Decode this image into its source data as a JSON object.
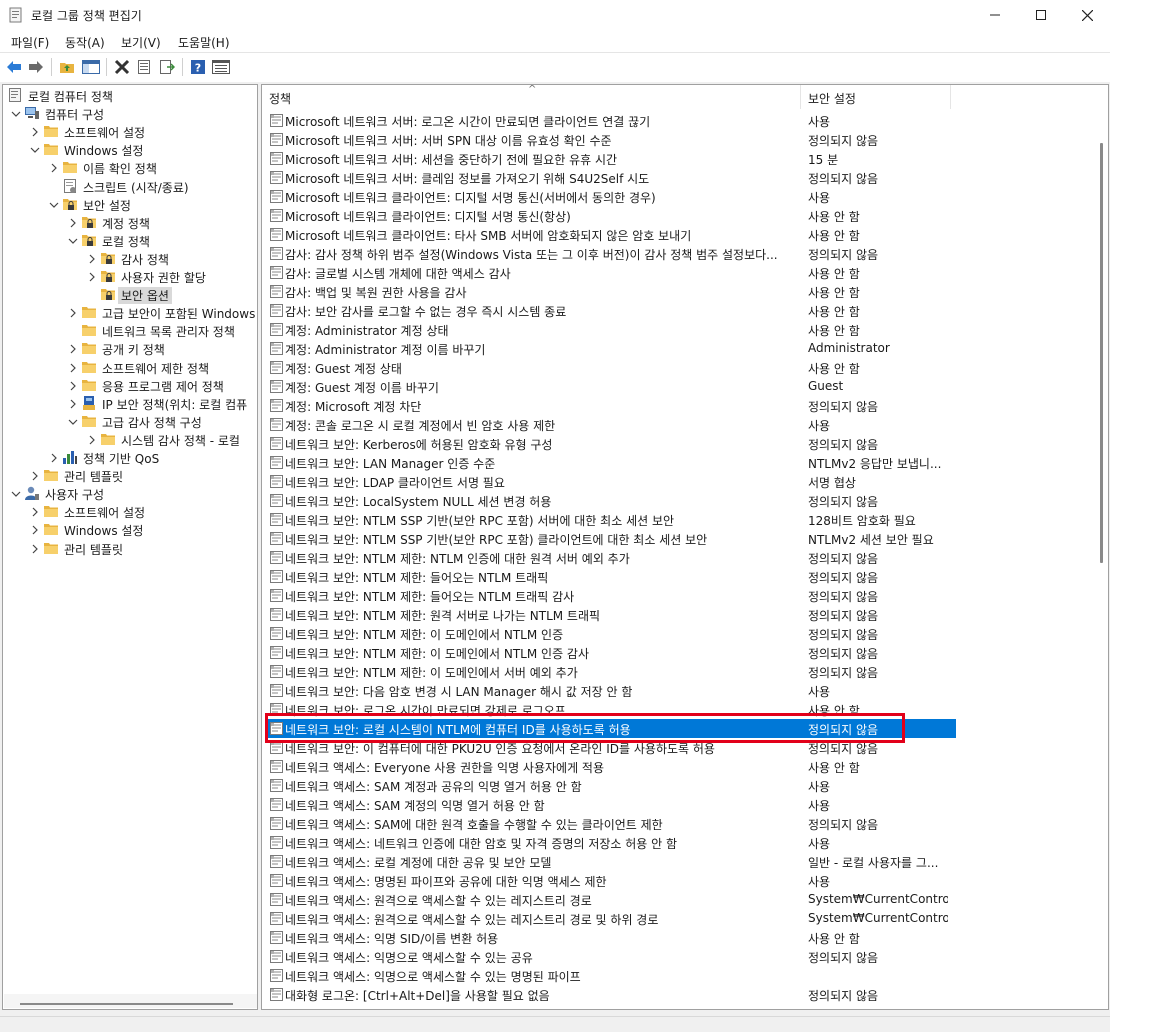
{
  "window": {
    "title": "로컬 그룹 정책 편집기"
  },
  "menu": [
    {
      "label": "파일(F)"
    },
    {
      "label": "동작(A)"
    },
    {
      "label": "보기(V)"
    },
    {
      "label": "도움말(H)"
    }
  ],
  "toolbar": {
    "icons": [
      "back-icon",
      "forward-icon",
      "up-folder-icon",
      "show-hide-tree-icon",
      "delete-icon",
      "properties-icon",
      "export-list-icon",
      "help-icon",
      "details-view-icon"
    ]
  },
  "tree": [
    {
      "label": "로컬 컴퓨터 정책",
      "level": 0,
      "chevron": "none",
      "icon": "policy"
    },
    {
      "label": "컴퓨터 구성",
      "level": 1,
      "chevron": "down",
      "icon": "computer"
    },
    {
      "label": "소프트웨어 설정",
      "level": 2,
      "chevron": "right",
      "icon": "folder"
    },
    {
      "label": "Windows 설정",
      "level": 2,
      "chevron": "down",
      "icon": "folder"
    },
    {
      "label": "이름 확인 정책",
      "level": 3,
      "chevron": "right",
      "icon": "folder"
    },
    {
      "label": "스크립트 (시작/종료)",
      "level": 3,
      "chevron": "none",
      "icon": "script"
    },
    {
      "label": "보안 설정",
      "level": 3,
      "chevron": "down",
      "icon": "secfolder"
    },
    {
      "label": "계정 정책",
      "level": 4,
      "chevron": "right",
      "icon": "secfolder"
    },
    {
      "label": "로컬 정책",
      "level": 4,
      "chevron": "down",
      "icon": "secfolder"
    },
    {
      "label": "감사 정책",
      "level": 5,
      "chevron": "right",
      "icon": "secfolder"
    },
    {
      "label": "사용자 권한 할당",
      "level": 5,
      "chevron": "right",
      "icon": "secfolder"
    },
    {
      "label": "보안 옵션",
      "level": 5,
      "chevron": "none",
      "icon": "secfolder",
      "selected": true
    },
    {
      "label": "고급 보안이 포함된 Windows",
      "level": 4,
      "chevron": "right",
      "icon": "folder"
    },
    {
      "label": "네트워크 목록 관리자 정책",
      "level": 4,
      "chevron": "none",
      "icon": "folder"
    },
    {
      "label": "공개 키 정책",
      "level": 4,
      "chevron": "right",
      "icon": "folder"
    },
    {
      "label": "소프트웨어 제한 정책",
      "level": 4,
      "chevron": "right",
      "icon": "folder"
    },
    {
      "label": "응용 프로그램 제어 정책",
      "level": 4,
      "chevron": "right",
      "icon": "folder"
    },
    {
      "label": "IP 보안 정책(위치: 로컬 컴퓨",
      "level": 4,
      "chevron": "right",
      "icon": "ipsec"
    },
    {
      "label": "고급 감사 정책 구성",
      "level": 4,
      "chevron": "down",
      "icon": "folder"
    },
    {
      "label": "시스템 감사 정책 - 로컬",
      "level": 5,
      "chevron": "right",
      "icon": "folder"
    },
    {
      "label": "정책 기반 QoS",
      "level": 3,
      "chevron": "right",
      "icon": "chart"
    },
    {
      "label": "관리 템플릿",
      "level": 2,
      "chevron": "right",
      "icon": "folder"
    },
    {
      "label": "사용자 구성",
      "level": 1,
      "chevron": "down",
      "icon": "user"
    },
    {
      "label": "소프트웨어 설정",
      "level": 2,
      "chevron": "right",
      "icon": "folder"
    },
    {
      "label": "Windows 설정",
      "level": 2,
      "chevron": "right",
      "icon": "folder"
    },
    {
      "label": "관리 템플릿",
      "level": 2,
      "chevron": "right",
      "icon": "folder"
    }
  ],
  "columns": {
    "policy": "정책",
    "setting": "보안 설정"
  },
  "policies": [
    {
      "name": "Microsoft 네트워크 서버: 로그온 시간이 만료되면 클라이언트 연결 끊기",
      "value": "사용"
    },
    {
      "name": "Microsoft 네트워크 서버: 서버 SPN 대상 이름 유효성 확인 수준",
      "value": "정의되지 않음"
    },
    {
      "name": "Microsoft 네트워크 서버: 세션을 중단하기 전에 필요한 유휴 시간",
      "value": "15 분"
    },
    {
      "name": "Microsoft 네트워크 서버: 클레임 정보를 가져오기 위해 S4U2Self 시도",
      "value": "정의되지 않음"
    },
    {
      "name": "Microsoft 네트워크 클라이언트: 디지털 서명 통신(서버에서 동의한 경우)",
      "value": "사용"
    },
    {
      "name": "Microsoft 네트워크 클라이언트: 디지털 서명 통신(항상)",
      "value": "사용 안 함"
    },
    {
      "name": "Microsoft 네트워크 클라이언트: 타사 SMB 서버에 암호화되지 않은 암호 보내기",
      "value": "사용 안 함"
    },
    {
      "name": "감사: 감사 정책 하위 범주 설정(Windows Vista 또는 그 이후 버전)이 감사 정책 범주 설정보다...",
      "value": "정의되지 않음"
    },
    {
      "name": "감사: 글로벌 시스템 개체에 대한 액세스 감사",
      "value": "사용 안 함"
    },
    {
      "name": "감사: 백업 및 복원 권한 사용을 감사",
      "value": "사용 안 함"
    },
    {
      "name": "감사: 보안 감사를 로그할 수 없는 경우 즉시 시스템 종료",
      "value": "사용 안 함"
    },
    {
      "name": "계정: Administrator 계정 상태",
      "value": "사용 안 함"
    },
    {
      "name": "계정: Administrator 계정 이름 바꾸기",
      "value": "Administrator"
    },
    {
      "name": "계정: Guest 계정 상태",
      "value": "사용 안 함"
    },
    {
      "name": "계정: Guest 계정 이름 바꾸기",
      "value": "Guest"
    },
    {
      "name": "계정: Microsoft 계정 차단",
      "value": "정의되지 않음"
    },
    {
      "name": "계정: 콘솔 로그온 시 로컬 계정에서 빈 암호 사용 제한",
      "value": "사용"
    },
    {
      "name": "네트워크 보안: Kerberos에 허용된 암호화 유형 구성",
      "value": "정의되지 않음"
    },
    {
      "name": "네트워크 보안: LAN Manager 인증 수준",
      "value": "NTLMv2 응답만 보냅니..."
    },
    {
      "name": "네트워크 보안: LDAP 클라이언트 서명 필요",
      "value": "서명 협상"
    },
    {
      "name": "네트워크 보안: LocalSystem NULL 세션 변경 허용",
      "value": "정의되지 않음"
    },
    {
      "name": "네트워크 보안: NTLM SSP 기반(보안 RPC 포함) 서버에 대한 최소 세션 보안",
      "value": "128비트 암호화 필요"
    },
    {
      "name": "네트워크 보안: NTLM SSP 기반(보안 RPC 포함) 클라이언트에 대한 최소 세션 보안",
      "value": "NTLMv2 세션 보안 필요"
    },
    {
      "name": "네트워크 보안: NTLM 제한: NTLM 인증에 대한 원격 서버 예외 추가",
      "value": "정의되지 않음"
    },
    {
      "name": "네트워크 보안: NTLM 제한: 들어오는 NTLM 트래픽",
      "value": "정의되지 않음"
    },
    {
      "name": "네트워크 보안: NTLM 제한: 들어오는 NTLM 트래픽 감사",
      "value": "정의되지 않음"
    },
    {
      "name": "네트워크 보안: NTLM 제한: 원격 서버로 나가는 NTLM 트래픽",
      "value": "정의되지 않음"
    },
    {
      "name": "네트워크 보안: NTLM 제한: 이 도메인에서 NTLM 인증",
      "value": "정의되지 않음"
    },
    {
      "name": "네트워크 보안: NTLM 제한: 이 도메인에서 NTLM 인증 감사",
      "value": "정의되지 않음"
    },
    {
      "name": "네트워크 보안: NTLM 제한: 이 도메인에서 서버 예외 추가",
      "value": "정의되지 않음"
    },
    {
      "name": "네트워크 보안: 다음 암호 변경 시 LAN Manager 해시 값 저장 안 함",
      "value": "사용"
    },
    {
      "name": "네트워크 보안: 로그온 시간이 만료되면 강제로 로그오프",
      "value": "사용 안 함"
    },
    {
      "name": "네트워크 보안: 로컬 시스템이 NTLM에 컴퓨터 ID를 사용하도록 허용",
      "value": "정의되지 않음",
      "selected": true
    },
    {
      "name": "네트워크 보안: 이 컴퓨터에 대한 PKU2U 인증 요청에서 온라인 ID를 사용하도록 허용",
      "value": "정의되지 않음"
    },
    {
      "name": "네트워크 액세스: Everyone 사용 권한을 익명 사용자에게 적용",
      "value": "사용 안 함"
    },
    {
      "name": "네트워크 액세스: SAM 계정과 공유의 익명 열거 허용 안 함",
      "value": "사용"
    },
    {
      "name": "네트워크 액세스: SAM 계정의 익명 열거 허용 안 함",
      "value": "사용"
    },
    {
      "name": "네트워크 액세스: SAM에 대한 원격 호출을 수행할 수 있는 클라이언트 제한",
      "value": "정의되지 않음"
    },
    {
      "name": "네트워크 액세스: 네트워크 인증에 대한 암호 및 자격 증명의 저장소 허용 안 함",
      "value": "사용"
    },
    {
      "name": "네트워크 액세스: 로컬 계정에 대한 공유 및 보안 모델",
      "value": "일반 - 로컬 사용자를 그..."
    },
    {
      "name": "네트워크 액세스: 명명된 파이프와 공유에 대한 익명 액세스 제한",
      "value": "사용"
    },
    {
      "name": "네트워크 액세스: 원격으로 액세스할 수 있는 레지스트리 경로",
      "value": "System₩CurrentControl..."
    },
    {
      "name": "네트워크 액세스: 원격으로 액세스할 수 있는 레지스트리 경로 및 하위 경로",
      "value": "System₩CurrentControl..."
    },
    {
      "name": "네트워크 액세스: 익명 SID/이름 변환 허용",
      "value": "사용 안 함"
    },
    {
      "name": "네트워크 액세스: 익명으로 액세스할 수 있는 공유",
      "value": "정의되지 않음"
    },
    {
      "name": "네트워크 액세스: 익명으로 액세스할 수 있는 명명된 파이프",
      "value": ""
    },
    {
      "name": "대화형 로그온: [Ctrl+Alt+Del]을 사용할 필요 없음",
      "value": "정의되지 않음"
    }
  ]
}
